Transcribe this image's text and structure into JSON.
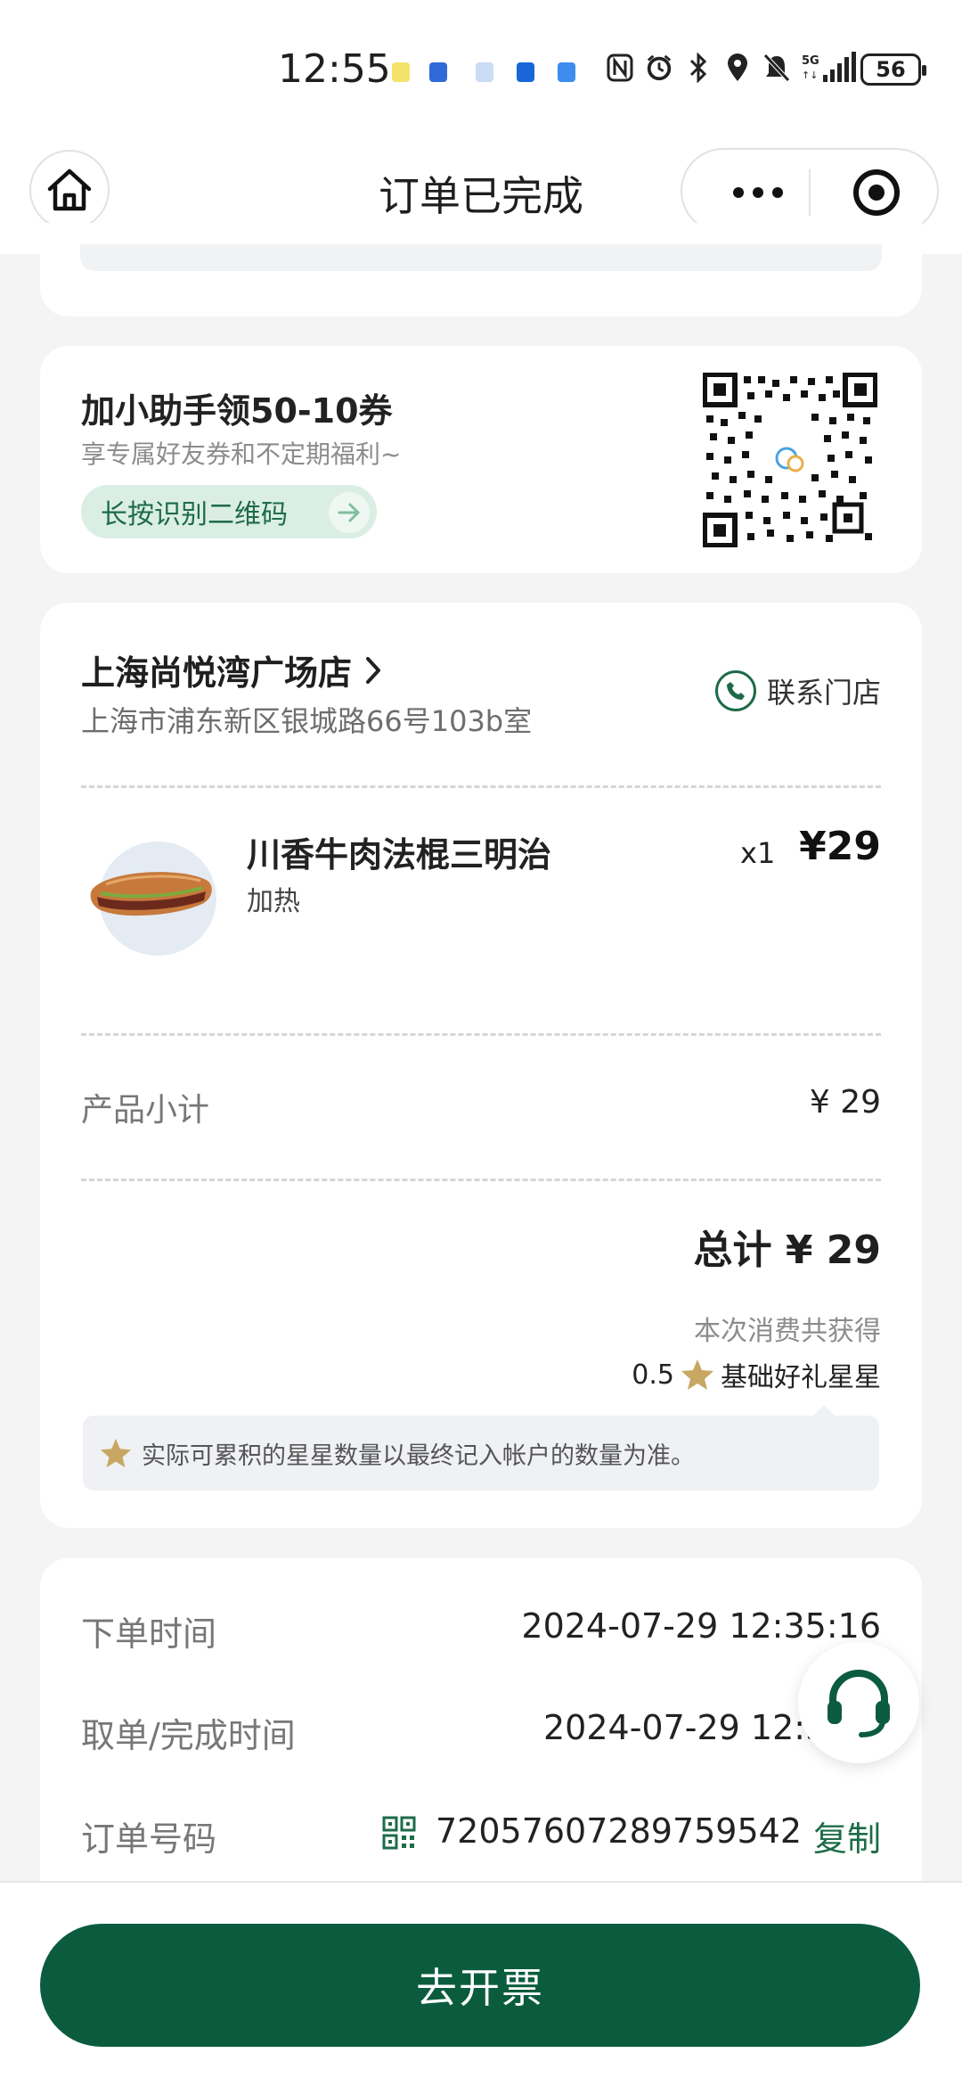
{
  "status_bar": {
    "time": "12:55",
    "network": "5G",
    "battery": "56"
  },
  "nav": {
    "title": "订单已完成"
  },
  "promo": {
    "title": "加小助手领50-10券",
    "subtitle": "享专属好友券和不定期福利~",
    "button_label": "长按识别二维码"
  },
  "store": {
    "name": "上海尚悦湾广场店",
    "address": "上海市浦东新区银城路66号103b室",
    "contact_label": "联系门店"
  },
  "item": {
    "name": "川香牛肉法棍三明治",
    "option": "加热",
    "quantity": "x1",
    "price": "¥29"
  },
  "summary": {
    "subtotal_label": "产品小计",
    "subtotal_value": "¥ 29",
    "total": "总计 ¥ 29",
    "earn_label": "本次消费共获得",
    "earn_amount": "0.5",
    "earn_unit": "基础好礼星星",
    "notice": "实际可累积的星星数量以最终记入帐户的数量为准。"
  },
  "info": {
    "order_time_label": "下单时间",
    "order_time_value": "2024-07-29 12:35:16",
    "complete_time_label": "取单/完成时间",
    "complete_time_value": "2024-07-29 12:3",
    "order_no_label": "订单号码",
    "order_no_value": "72057607289759542",
    "copy_label": "复制"
  },
  "bottom": {
    "invoice_label": "去开票"
  },
  "colors": {
    "brand_green": "#0b5c3e",
    "accent_green": "#1d6b48",
    "star_gold": "#c7a762"
  }
}
